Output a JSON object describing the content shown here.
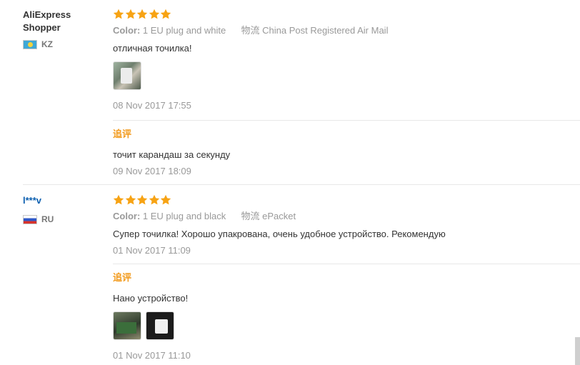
{
  "reviews": [
    {
      "user_name_line1": "AliExpress",
      "user_name_line2": "Shopper",
      "country_code": "KZ",
      "stars": 5,
      "color_label": "Color:",
      "color_value": "1 EU plug and white",
      "logistics_label": "物流",
      "logistics_value": "China Post Registered Air Mail",
      "text": "отличная точилка!",
      "date": "08 Nov 2017 17:55",
      "additional_label": "追评",
      "additional_text": "точит карандаш за секунду",
      "additional_date": "09 Nov 2017 18:09"
    },
    {
      "user_name": "l***v",
      "country_code": "RU",
      "stars": 5,
      "color_label": "Color:",
      "color_value": "1 EU plug and black",
      "logistics_label": "物流",
      "logistics_value": "ePacket",
      "text": "Супер точилка! Хорошо упакрована, очень удобное устройство. Рекомендую",
      "date": "01 Nov 2017 11:09",
      "additional_label": "追评",
      "additional_text": "Нано устройство!",
      "additional_date": "01 Nov 2017 11:10"
    }
  ],
  "colors": {
    "star": "#f7a314",
    "additional_label": "#f29a1c",
    "muted_text": "#999999",
    "link": "#0b5fb0"
  }
}
